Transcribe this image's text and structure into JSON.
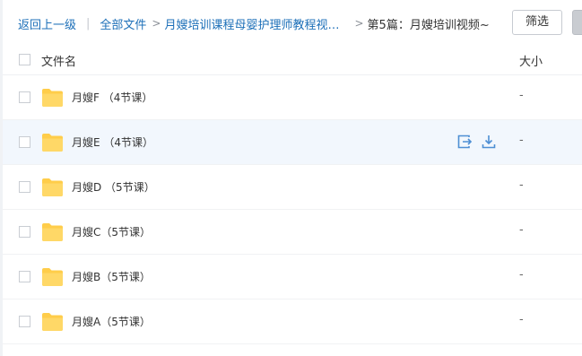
{
  "breadcrumb": {
    "back": "返回上一级",
    "all_files": "全部文件",
    "parent_folder": "月嫂培训课程母婴护理师教程视频…",
    "current_folder": "第5篇：月嫂培训视频~"
  },
  "toolbar": {
    "filter_label": "筛选"
  },
  "table": {
    "col_name": "文件名",
    "col_size": "大小"
  },
  "rows": [
    {
      "name": "月嫂F （4节课）",
      "size": "-"
    },
    {
      "name": "月嫂E （4节课）",
      "size": "-"
    },
    {
      "name": "月嫂D （5节课）",
      "size": "-"
    },
    {
      "name": "月嫂C（5节课）",
      "size": "-"
    },
    {
      "name": "月嫂B（5节课）",
      "size": "-"
    },
    {
      "name": "月嫂A（5节课）",
      "size": "-"
    }
  ],
  "icons": {
    "folder": "folder-icon",
    "share": "share-icon",
    "download": "download-icon"
  },
  "colors": {
    "link": "#1c6fb8",
    "folder": "#ffcd4a",
    "hover_row": "#f2f7fd",
    "action_icon": "#4e8fd4"
  }
}
